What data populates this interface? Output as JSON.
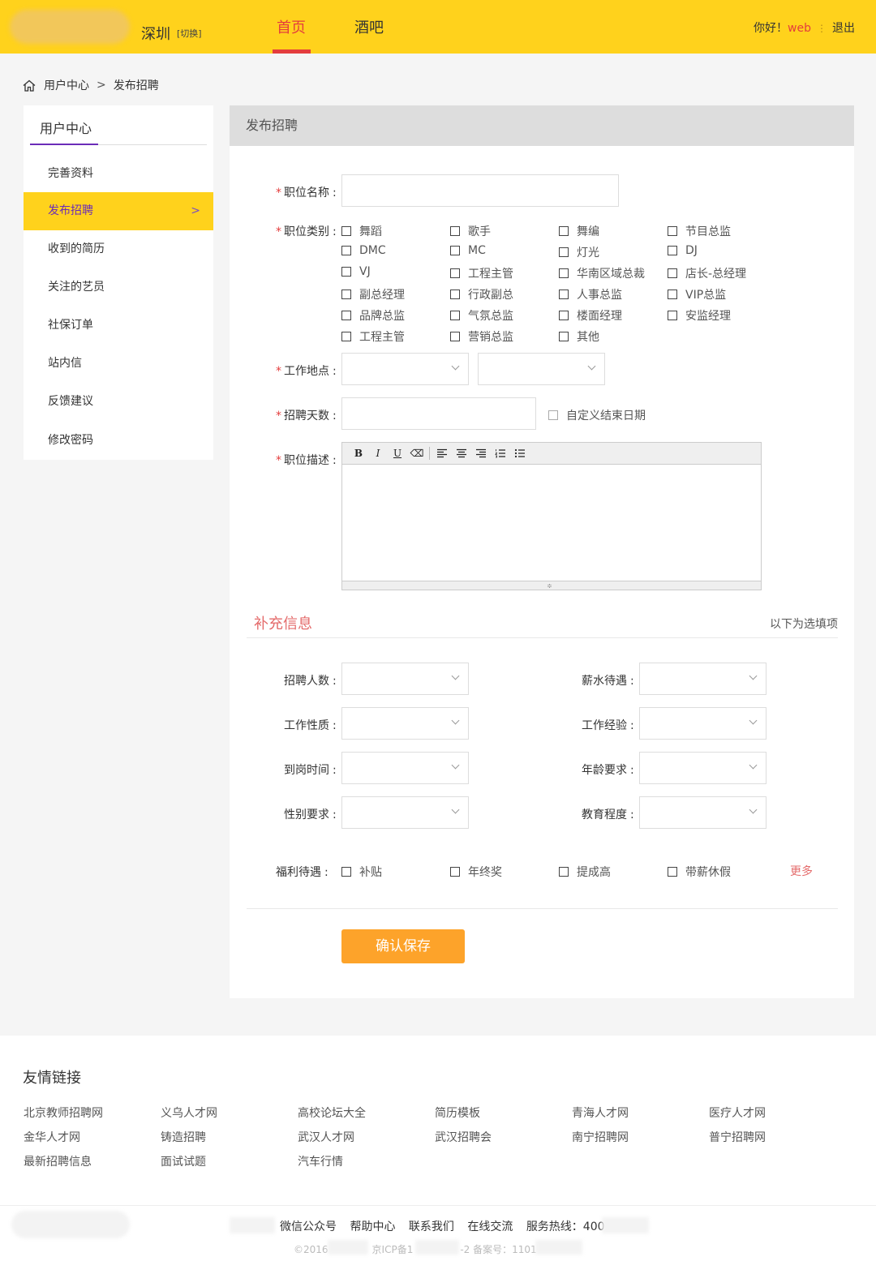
{
  "header": {
    "city": "深圳",
    "city_switch": "[切换]",
    "nav": [
      "首页",
      "酒吧"
    ],
    "greeting_prefix": "你好！",
    "username": "web",
    "separator": "⋮",
    "logout": "退出"
  },
  "breadcrumb": {
    "root": "用户中心",
    "arrow": ">",
    "current": "发布招聘"
  },
  "sidebar": {
    "title": "用户中心",
    "items": [
      "完善资料",
      "发布招聘",
      "收到的简历",
      "关注的艺员",
      "社保订单",
      "站内信",
      "反馈建议",
      "修改密码"
    ],
    "active_chevron": ">"
  },
  "form": {
    "panel_title": "发布招聘",
    "required_mark": "*",
    "colon": ":",
    "job_name_label": "职位名称",
    "job_category_label": "职位类别",
    "categories": [
      "舞蹈",
      "歌手",
      "舞编",
      "节目总监",
      "DMC",
      "MC",
      "灯光",
      "DJ",
      "VJ",
      "工程主管",
      "华南区域总裁",
      "店长-总经理",
      "副总经理",
      "行政副总",
      "人事总监",
      "VIP总监",
      "品牌总监",
      "气氛总监",
      "楼面经理",
      "安监经理",
      "工程主管",
      "营销总监",
      "其他"
    ],
    "work_location_label": "工作地点",
    "recruit_days_label": "招聘天数",
    "custom_end_date": "自定义结束日期",
    "job_desc_label": "职位描述",
    "toolbar": {
      "bold": "B",
      "italic": "I",
      "underline": "U",
      "eraser": "⌫",
      "grip": "≑"
    },
    "extra_title": "补充信息",
    "extra_hint": "以下为选填项",
    "extra_left": [
      "招聘人数",
      "工作性质",
      "到岗时间",
      "性别要求"
    ],
    "extra_right": [
      "薪水待遇",
      "工作经验",
      "年龄要求",
      "教育程度"
    ],
    "benefits_label": "福利待遇",
    "benefits": [
      "补贴",
      "年终奖",
      "提成高",
      "带薪休假"
    ],
    "more": "更多",
    "save": "确认保存"
  },
  "footer": {
    "friend_title": "友情链接",
    "links": [
      "北京教师招聘网",
      "义乌人才网",
      "高校论坛大全",
      "简历模板",
      "青海人才网",
      "医疗人才网",
      "金华人才网",
      "铸造招聘",
      "武汉人才网",
      "武汉招聘会",
      "南宁招聘网",
      "普宁招聘网",
      "最新招聘信息",
      "面试试题",
      "汽车行情"
    ],
    "nav": [
      "微信公众号",
      "帮助中心",
      "联系我们",
      "在线交流",
      "服务热线：400-"
    ],
    "copyright_a": "©2016",
    "copyright_b": "京ICP备1",
    "copyright_c": "-2 备案号：1101"
  },
  "colors": {
    "header_bg": "#ffd21c",
    "accent_red": "#e43d3d",
    "accent_purple": "#6b2cb8",
    "save_orange": "#fda32a"
  }
}
